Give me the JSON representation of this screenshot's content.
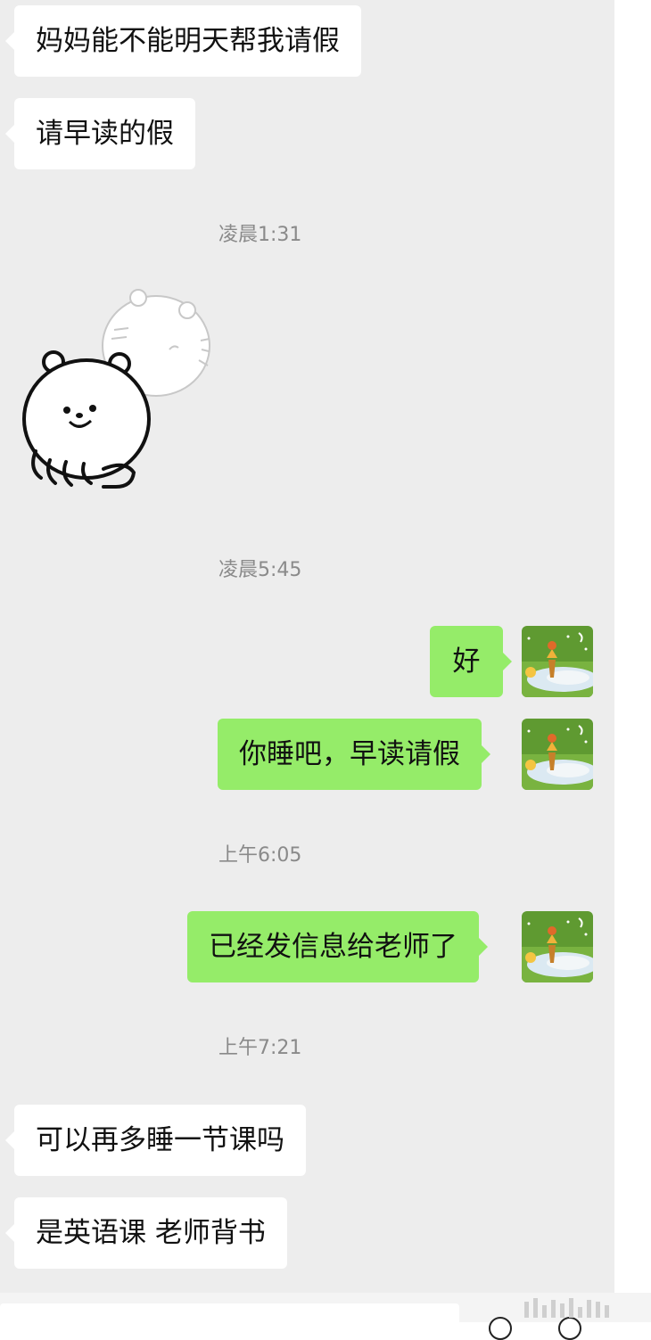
{
  "messages": [
    {
      "side": "left",
      "text": "妈妈能不能明天帮我请假"
    },
    {
      "side": "left",
      "text": "请早读的假"
    },
    {
      "type": "time",
      "text": "凌晨1:31"
    },
    {
      "type": "sticker",
      "icon": "bear-sticker-icon",
      "side": "left"
    },
    {
      "type": "time",
      "text": "凌晨5:45"
    },
    {
      "side": "right",
      "text": "好"
    },
    {
      "side": "right",
      "text": "你睡吧，早读请假"
    },
    {
      "type": "time",
      "text": "上午6:05"
    },
    {
      "side": "right",
      "text": "已经发信息给老师了"
    },
    {
      "type": "time",
      "text": "上午7:21"
    },
    {
      "side": "left",
      "text": "可以再多睡一节课吗"
    },
    {
      "side": "left",
      "text": "是英语课 老师背书"
    }
  ],
  "colors": {
    "chat_background": "#ededed",
    "received_bubble": "#ffffff",
    "sent_bubble": "#95ec69",
    "timestamp_text": "#8a8a8a"
  },
  "avatar_icon": "user-avatar-icon"
}
